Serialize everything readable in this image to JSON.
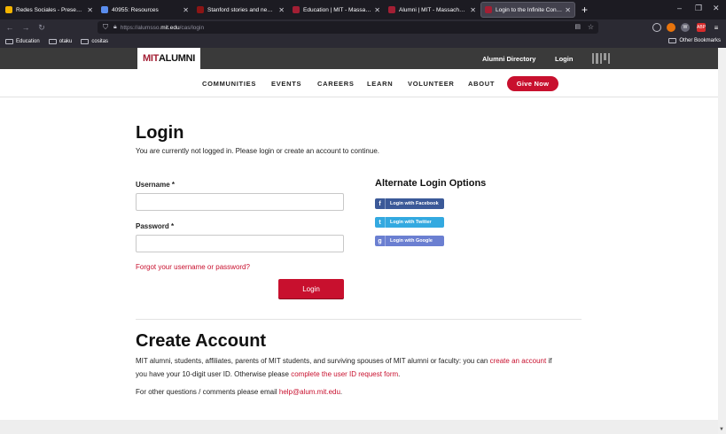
{
  "browser": {
    "tabs": [
      {
        "title": "Redes Sociales - Presentacion...",
        "favicon_color": "#f4b400"
      },
      {
        "title": "40955: Resources",
        "favicon_color": "#5a8dee"
      },
      {
        "title": "Stanford stories and news | Sta...",
        "favicon_color": "#8c1515"
      },
      {
        "title": "Education | MIT - Massachusett...",
        "favicon_color": "#a31f34"
      },
      {
        "title": "Alumni | MIT - Massachusetts In...",
        "favicon_color": "#a31f34"
      },
      {
        "title": "Login to the Infinite Connection",
        "favicon_color": "#a31f34"
      }
    ],
    "url_prefix": "https://alumsso.",
    "url_domain": "mit.edu",
    "url_suffix": "/cas/login",
    "bookmarks": [
      "Education",
      "otaku",
      "cositas"
    ],
    "other_bookmarks": "Other Bookmarks",
    "extensions": [
      {
        "label": "",
        "color": "#5b5b66"
      },
      {
        "label": "",
        "color": "#e8740c"
      },
      {
        "label": "W",
        "color": "#6a6a78"
      },
      {
        "label": "ABP",
        "color": "#d92b2b"
      }
    ]
  },
  "site": {
    "logo_mit": "MIT",
    "logo_alumni": "ALUMNI",
    "top_links": [
      "Alumni Directory",
      "Login"
    ],
    "nav": [
      "COMMUNITIES",
      "EVENTS",
      "CAREERS",
      "LEARN",
      "VOLUNTEER",
      "ABOUT"
    ],
    "give_label": "Give Now"
  },
  "login": {
    "title": "Login",
    "subtitle": "You are currently not logged in. Please login or create an account to continue.",
    "username_label": "Username *",
    "password_label": "Password *",
    "forgot_link": "Forgot your username or password?",
    "button": "Login"
  },
  "alternate": {
    "title": "Alternate Login Options",
    "options": [
      {
        "label": "Login with Facebook",
        "icon": "facebook-icon",
        "glyph": "f",
        "color": "#3b5998"
      },
      {
        "label": "Login with Twitter",
        "icon": "twitter-icon",
        "glyph": "t",
        "color": "#33a9e0"
      },
      {
        "label": "Login with Google",
        "icon": "google-icon",
        "glyph": "g",
        "color": "#6b7fd1"
      }
    ]
  },
  "create": {
    "title": "Create Account",
    "para1_a": "MIT alumni, students, affiliates, parents of MIT students, and surviving spouses of MIT alumni or faculty: you can",
    "para1_link": "create an account",
    "para1_b": "if",
    "para2_a": "you have your 10-digit user ID. Otherwise please",
    "para2_link": "complete the user ID request form",
    "para2_b": ".",
    "contact_a": "For other questions / comments please email",
    "contact_link": "help@alum.mit.edu",
    "contact_b": "."
  }
}
